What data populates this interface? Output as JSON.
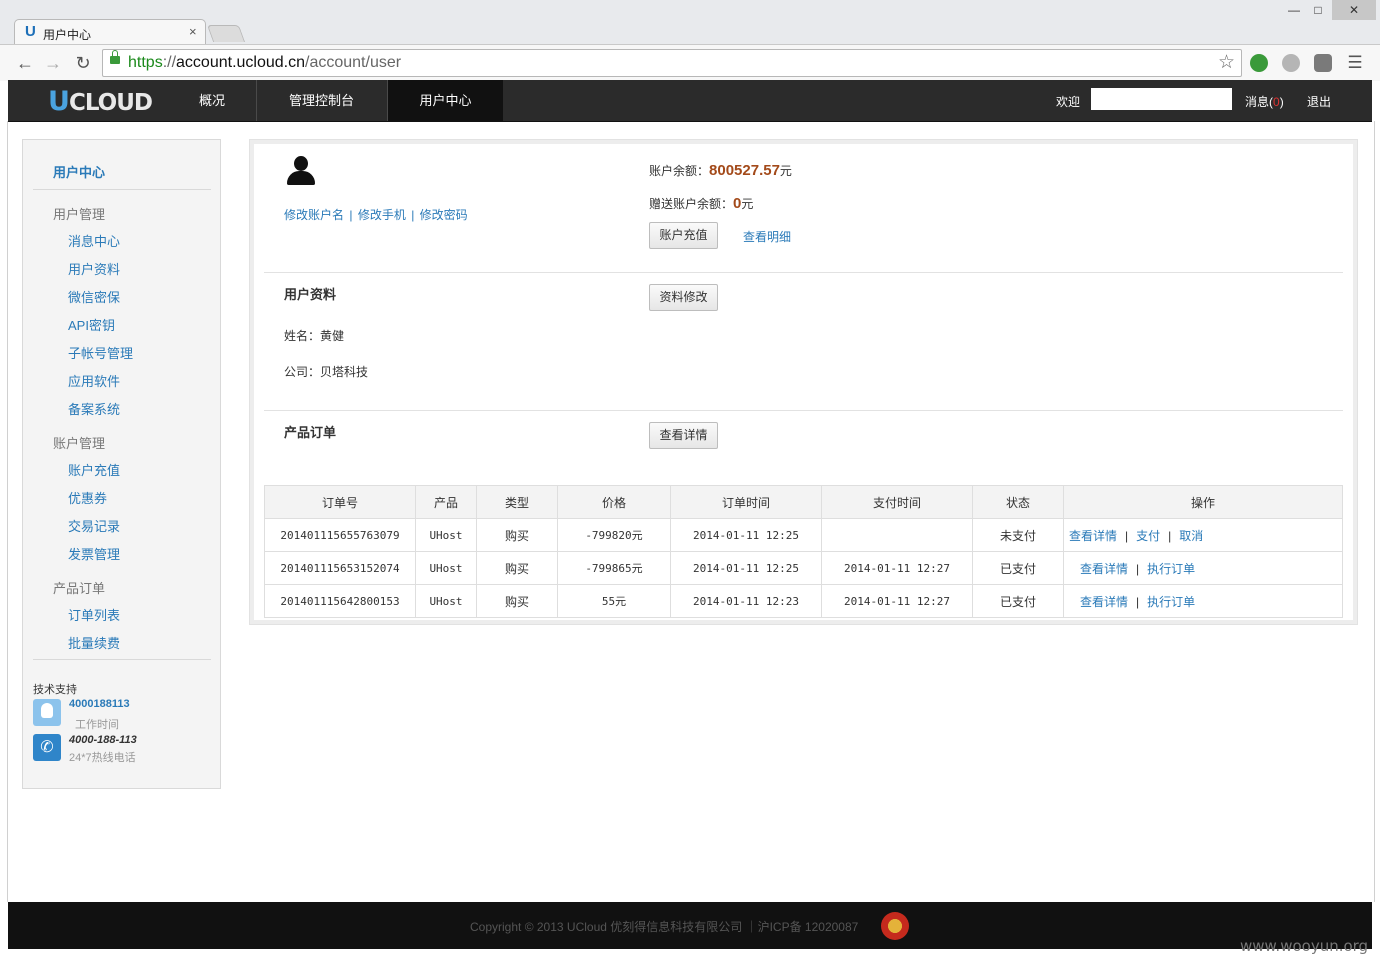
{
  "browser": {
    "tab_title": "用户中心",
    "tab_close": "×",
    "favicon": "U",
    "url_scheme": "https",
    "url_sep": "://",
    "url_host": "account.ucloud.cn",
    "url_path": "/account/user",
    "window_min": "—",
    "window_max": "□",
    "window_close": "✕"
  },
  "header": {
    "logo_u": "U",
    "logo_rest": "CLOUD",
    "nav": [
      {
        "label": "概况"
      },
      {
        "label": "管理控制台"
      },
      {
        "label": "用户中心"
      }
    ],
    "welcome": "欢迎",
    "messages_label": "消息(",
    "messages_count": "0",
    "messages_close": ")",
    "logout": "退出"
  },
  "sidebar": {
    "title": "用户中心",
    "group_user": "用户管理",
    "user_items": [
      "消息中心",
      "用户资料",
      "微信密保",
      "API密钥",
      "子帐号管理",
      "应用软件",
      "备案系统"
    ],
    "group_account": "账户管理",
    "account_items": [
      "账户充值",
      "优惠券",
      "交易记录",
      "发票管理"
    ],
    "group_orders": "产品订单",
    "order_items": [
      "订单列表",
      "批量续费"
    ],
    "support_label": "技术支持",
    "support_qq": "4000188113",
    "support_qq_sub": "工作时间",
    "support_phone": "4000-188-113",
    "support_phone_sub": "24*7热线电话"
  },
  "account": {
    "link_rename": "修改账户名",
    "link_phone": "修改手机",
    "link_password": "修改密码",
    "link_sep": "|",
    "balance_label": "账户余额：",
    "balance_value": "800527.57",
    "balance_unit": "元",
    "gift_label": "赠送账户余额：",
    "gift_value": "0",
    "gift_unit": "元",
    "recharge_button": "账户充值",
    "details_link": "查看明细"
  },
  "profile": {
    "title": "用户资料",
    "edit_button": "资料修改",
    "name_label": "姓名：",
    "name_value": "黄健",
    "company_label": "公司：",
    "company_value": "贝塔科技"
  },
  "orders": {
    "title": "产品订单",
    "details_button": "查看详情",
    "columns": [
      "订单号",
      "产品",
      "类型",
      "价格",
      "订单时间",
      "支付时间",
      "状态",
      "操作"
    ],
    "rows": [
      {
        "id": "201401115655763079",
        "product": "UHost",
        "type": "购买",
        "price": "-799820元",
        "order_time": "2014-01-11 12:25",
        "pay_time": "",
        "status": "未支付",
        "ops": [
          "查看详情",
          "支付",
          "取消"
        ]
      },
      {
        "id": "201401115653152074",
        "product": "UHost",
        "type": "购买",
        "price": "-799865元",
        "order_time": "2014-01-11 12:25",
        "pay_time": "2014-01-11 12:27",
        "status": "已支付",
        "ops": [
          "查看详情",
          "执行订单"
        ]
      },
      {
        "id": "201401115642800153",
        "product": "UHost",
        "type": "购买",
        "price": "55元",
        "order_time": "2014-01-11 12:23",
        "pay_time": "2014-01-11 12:27",
        "status": "已支付",
        "ops": [
          "查看详情",
          "执行订单"
        ]
      }
    ],
    "op_sep": "|"
  },
  "footer": {
    "copyright": "Copyright © 2013 UCloud 优刻得信息科技有限公司 ｜沪ICP备 12020087"
  },
  "watermark": "www.wooyun.org"
}
